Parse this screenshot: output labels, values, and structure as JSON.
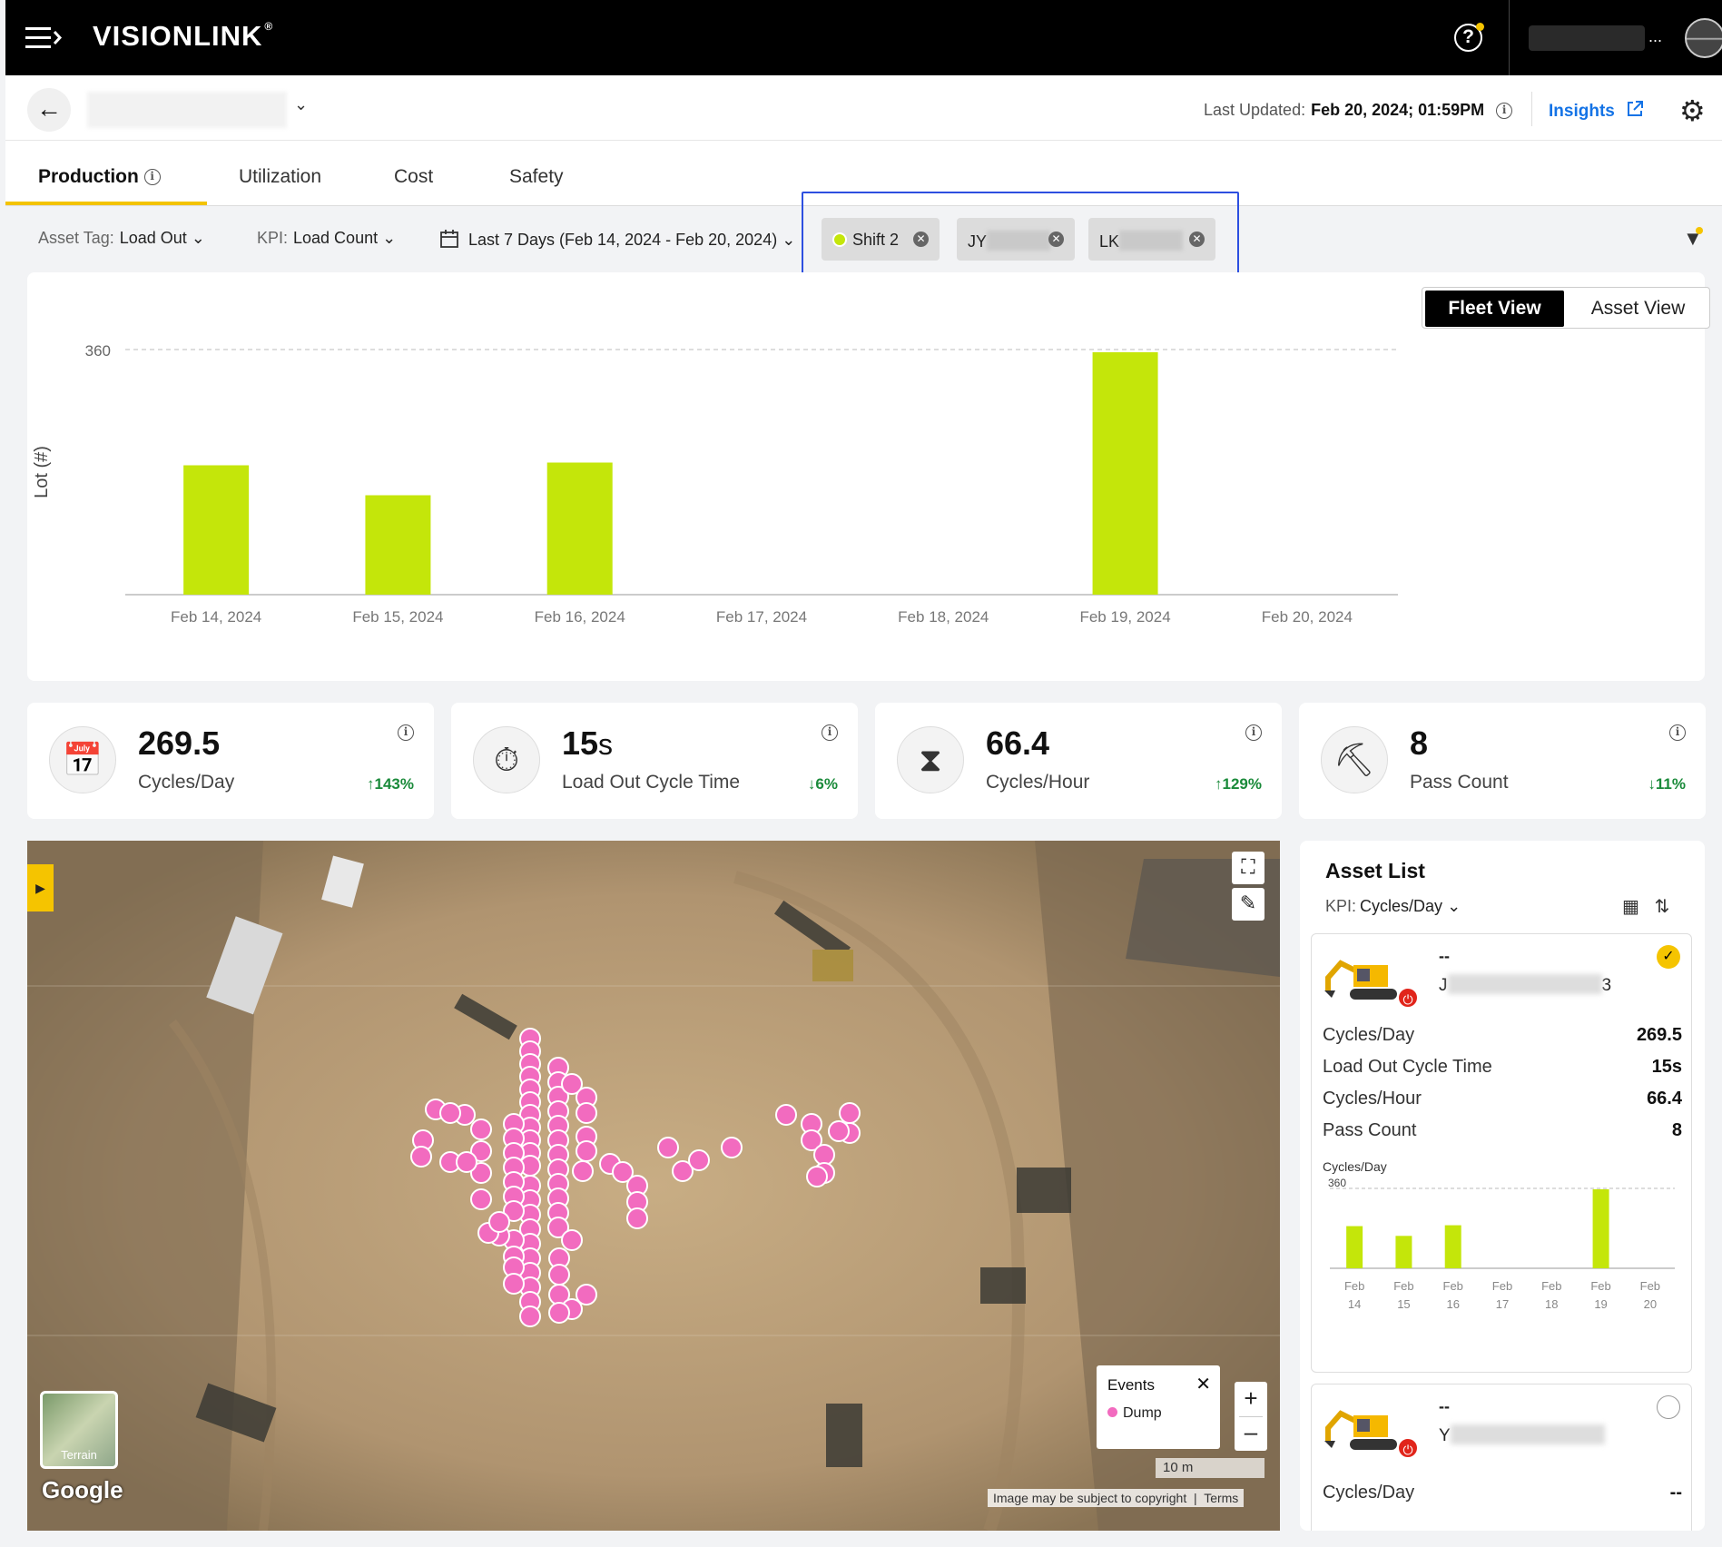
{
  "app": {
    "brand": "VISIONLINK",
    "brand_mark": "®"
  },
  "topbar": {
    "help_glyph": "?",
    "user_more": "..."
  },
  "header": {
    "last_updated_label": "Last Updated:",
    "last_updated_value": "Feb 20, 2024; 01:59PM",
    "insights_label": "Insights"
  },
  "tabs": [
    {
      "label": "Production",
      "active": true
    },
    {
      "label": "Utilization"
    },
    {
      "label": "Cost"
    },
    {
      "label": "Safety"
    }
  ],
  "filters": {
    "asset_tag_label": "Asset Tag:",
    "asset_tag_value": "Load Out",
    "kpi_label": "KPI:",
    "kpi_value": "Load Count",
    "date_range": "Last 7 Days (Feb 14, 2024 - Feb 20, 2024)",
    "chips": [
      {
        "label": "Shift 2"
      },
      {
        "label": "JY"
      },
      {
        "label": "LK"
      }
    ]
  },
  "view_toggle": {
    "fleet": "Fleet View",
    "asset": "Asset View"
  },
  "chart_data": {
    "type": "bar",
    "categories": [
      "Feb 14, 2024",
      "Feb 15, 2024",
      "Feb 16, 2024",
      "Feb 17, 2024",
      "Feb 18, 2024",
      "Feb 19, 2024",
      "Feb 20, 2024"
    ],
    "values": [
      190,
      146,
      194,
      0,
      0,
      356,
      0
    ],
    "ylabel": "Lot (#)",
    "yticks": [
      360
    ],
    "ylim": [
      0,
      360
    ],
    "reference_line": 360,
    "color": "#c4e60a"
  },
  "kpi_cards": [
    {
      "value": "269.5",
      "label": "Cycles/Day",
      "delta": "143%",
      "direction": "up",
      "icon": "calendar-cycle-icon"
    },
    {
      "value": "15",
      "unit": "s",
      "label": "Load Out Cycle Time",
      "delta": "6%",
      "direction": "down",
      "icon": "clock-cycle-icon"
    },
    {
      "value": "66.4",
      "label": "Cycles/Hour",
      "delta": "129%",
      "direction": "up",
      "icon": "hourglass-cycle-icon"
    },
    {
      "value": "8",
      "label": "Pass Count",
      "delta": "11%",
      "direction": "down",
      "icon": "bucket-pass-icon"
    }
  ],
  "map": {
    "events_title": "Events",
    "events_item": "Dump",
    "event_color": "#f26bbf",
    "terrain_label": "Terrain",
    "google_label": "Google",
    "scale_label": "10 m",
    "copyright": "Image may be subject to copyright",
    "terms": "Terms"
  },
  "asset_list": {
    "title": "Asset List",
    "kpi_label": "KPI:",
    "kpi_value": "Cycles/Day",
    "assets": [
      {
        "dash": "--",
        "name_prefix": "J",
        "name_suffix": "3",
        "selected": true,
        "metrics": [
          {
            "label": "Cycles/Day",
            "value": "269.5"
          },
          {
            "label": "Load Out Cycle Time",
            "value": "15s"
          },
          {
            "label": "Cycles/Hour",
            "value": "66.4"
          },
          {
            "label": "Pass Count",
            "value": "8"
          }
        ],
        "mini_chart": {
          "title": "Cycles/Day",
          "ytick": "360",
          "categories": [
            [
              "Feb",
              "14"
            ],
            [
              "Feb",
              "15"
            ],
            [
              "Feb",
              "16"
            ],
            [
              "Feb",
              "17"
            ],
            [
              "Feb",
              "18"
            ],
            [
              "Feb",
              "19"
            ],
            [
              "Feb",
              "20"
            ]
          ],
          "values": [
            190,
            146,
            194,
            0,
            0,
            356,
            0
          ]
        }
      },
      {
        "dash": "--",
        "name_prefix": "Y",
        "selected": false,
        "metrics": [
          {
            "label": "Cycles/Day",
            "value": "--"
          }
        ]
      }
    ]
  }
}
